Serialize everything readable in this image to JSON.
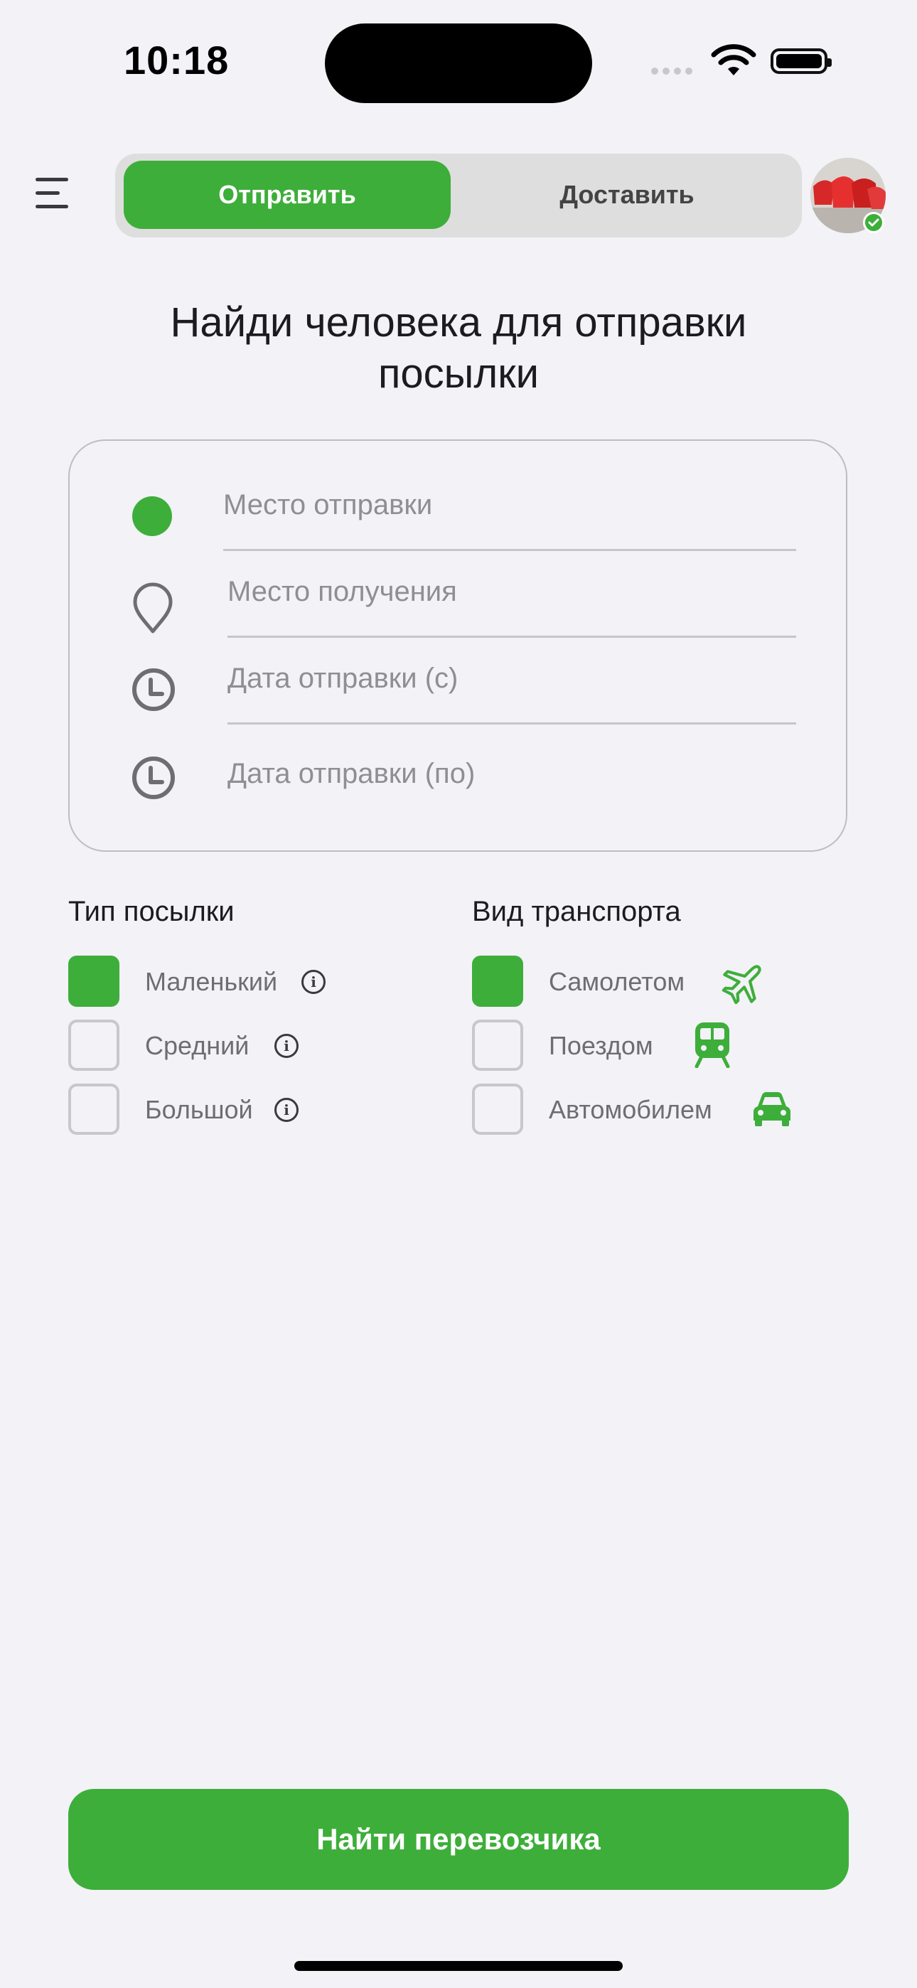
{
  "status_bar": {
    "time": "10:18"
  },
  "header": {
    "segments": [
      "Отправить",
      "Доставить"
    ],
    "active_segment": 0
  },
  "title": "Найди человека для отправки посылки",
  "form": {
    "from_placeholder": "Место отправки",
    "to_placeholder": "Место получения",
    "date_from_placeholder": "Дата отправки (с)",
    "date_to_placeholder": "Дата отправки (по)"
  },
  "parcel_type": {
    "title": "Тип посылки",
    "options": [
      {
        "label": "Маленький",
        "checked": true
      },
      {
        "label": "Средний",
        "checked": false
      },
      {
        "label": "Большой",
        "checked": false
      }
    ]
  },
  "transport": {
    "title": "Вид транспорта",
    "options": [
      {
        "label": "Самолетом",
        "checked": true,
        "icon": "airplane-icon"
      },
      {
        "label": "Поездом",
        "checked": false,
        "icon": "train-icon"
      },
      {
        "label": "Автомобилем",
        "checked": false,
        "icon": "car-icon"
      }
    ]
  },
  "cta_label": "Найти перевозчика",
  "colors": {
    "accent": "#3eae3a",
    "background": "#f2f2f7"
  }
}
